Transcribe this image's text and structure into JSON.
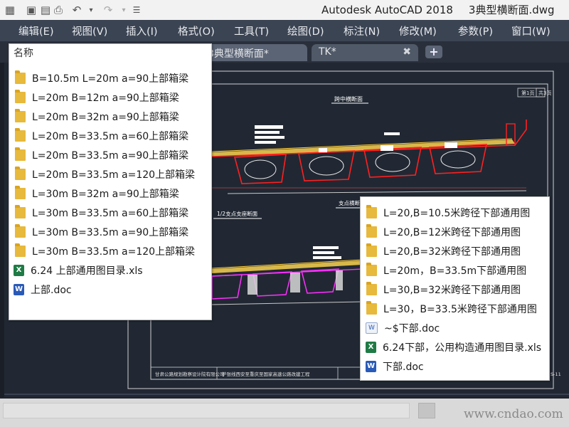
{
  "window": {
    "title": "Autodesk AutoCAD 2018",
    "file_name": "3典型横断面.dwg"
  },
  "menu": [
    "编辑(E)",
    "视图(V)",
    "插入(I)",
    "格式(O)",
    "工具(T)",
    "绘图(D)",
    "标注(N)",
    "修改(M)",
    "参数(P)",
    "窗口(W)"
  ],
  "tabs": [
    {
      "label": "3典型横断面*",
      "active": true
    },
    {
      "label": "TK*",
      "active": false
    }
  ],
  "drawing": {
    "section_title": "跨中横断面",
    "sheet_labels": [
      "第1页",
      "共3页"
    ],
    "left_section_title": "1/2支点支座断面",
    "right_section_title": "支点横断面",
    "footer_company": "甘肃公路规划勘察设计院有限公司",
    "footer_project": "护张线西安至重庆至国家高速公路改建工程",
    "footer_drawing_no": "S-11"
  },
  "left_panel": {
    "header": "名称",
    "items": [
      {
        "type": "folder",
        "name": "B=10.5m L=20m a=90上部箱梁"
      },
      {
        "type": "folder",
        "name": "L=20m B=12m a=90上部箱梁"
      },
      {
        "type": "folder",
        "name": "L=20m B=32m a=90上部箱梁"
      },
      {
        "type": "folder",
        "name": "L=20m B=33.5m a=60上部箱梁"
      },
      {
        "type": "folder",
        "name": "L=20m B=33.5m a=90上部箱梁"
      },
      {
        "type": "folder",
        "name": "L=20m B=33.5m a=120上部箱梁"
      },
      {
        "type": "folder",
        "name": "L=30m B=32m a=90上部箱梁"
      },
      {
        "type": "folder",
        "name": "L=30m B=33.5m a=60上部箱梁"
      },
      {
        "type": "folder",
        "name": "L=30m B=33.5m a=90上部箱梁"
      },
      {
        "type": "folder",
        "name": "L=30m B=33.5m a=120上部箱梁"
      },
      {
        "type": "xls",
        "name": "6.24 上部通用图目录.xls"
      },
      {
        "type": "doc",
        "name": "上部.doc"
      }
    ]
  },
  "right_panel": {
    "items": [
      {
        "type": "folder",
        "name": "L=20,B=10.5米跨径下部通用图"
      },
      {
        "type": "folder",
        "name": "L=20,B=12米跨径下部通用图"
      },
      {
        "type": "folder",
        "name": "L=20,B=32米跨径下部通用图"
      },
      {
        "type": "folder",
        "name": "L=20m，B=33.5m下部通用图"
      },
      {
        "type": "folder",
        "name": "L=30,B=32米跨径下部通用图"
      },
      {
        "type": "folder",
        "name": "L=30，B=33.5米跨径下部通用图"
      },
      {
        "type": "doc-tmp",
        "name": "~$下部.doc"
      },
      {
        "type": "xls",
        "name": "6.24下部，公用构造通用图目录.xls"
      },
      {
        "type": "doc",
        "name": "下部.doc"
      }
    ]
  },
  "watermark": "www.cndao.com"
}
